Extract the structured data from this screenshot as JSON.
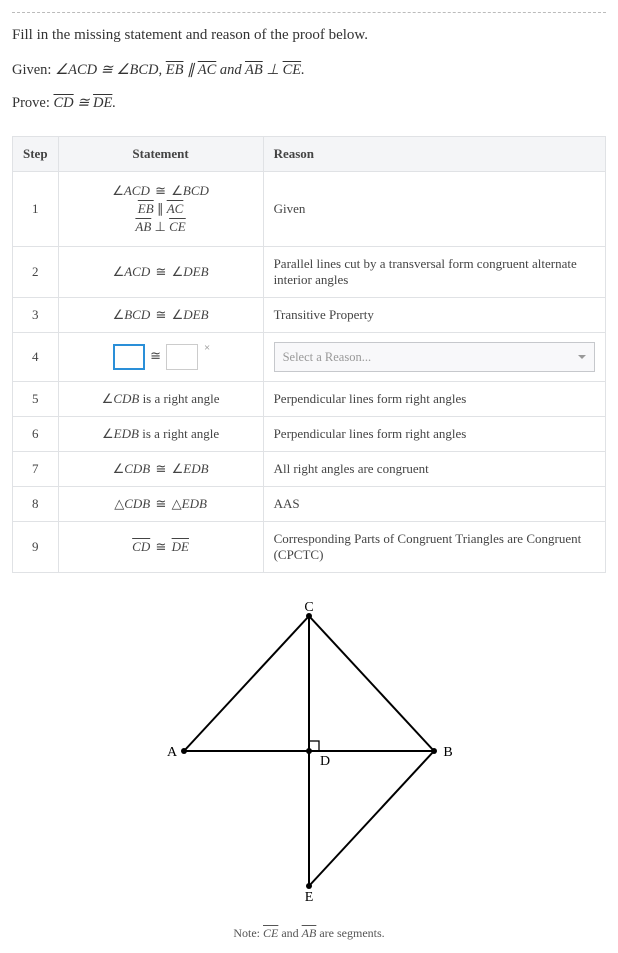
{
  "instruction": "Fill in the missing statement and reason of the proof below.",
  "given_label": "Given: ",
  "given_math": "∠ACD ≅ ∠BCD, EB ∥ AC and AB ⊥ CE.",
  "prove_label": "Prove: ",
  "prove_math": "CD ≅ DE.",
  "headers": {
    "step": "Step",
    "statement": "Statement",
    "reason": "Reason"
  },
  "rows": [
    {
      "step": "1",
      "statements": [
        "∠ACD ≅ ∠BCD",
        "EB ∥ AC",
        "AB ⊥ CE"
      ],
      "reason": "Given"
    },
    {
      "step": "2",
      "statements": [
        "∠ACD ≅ ∠DEB"
      ],
      "reason": "Parallel lines cut by a transversal form congruent alternate interior angles"
    },
    {
      "step": "3",
      "statements": [
        "∠BCD ≅ ∠DEB"
      ],
      "reason": "Transitive Property"
    },
    {
      "step": "4",
      "statements": [
        "__blank__"
      ],
      "reason": "__select__"
    },
    {
      "step": "5",
      "statements": [
        "∠CDB is a right angle"
      ],
      "reason": "Perpendicular lines form right angles"
    },
    {
      "step": "6",
      "statements": [
        "∠EDB is a right angle"
      ],
      "reason": "Perpendicular lines form right angles"
    },
    {
      "step": "7",
      "statements": [
        "∠CDB ≅ ∠EDB"
      ],
      "reason": "All right angles are congruent"
    },
    {
      "step": "8",
      "statements": [
        "△CDB ≅ △EDB"
      ],
      "reason": "AAS"
    },
    {
      "step": "9",
      "statements": [
        "CD ≅ DE"
      ],
      "reason": "Corresponding Parts of Congruent Triangles are Congruent (CPCTC)"
    }
  ],
  "select_placeholder": "Select a Reason...",
  "cong_symbol": "≅",
  "close_symbol": "×",
  "figure": {
    "labels": {
      "A": "A",
      "B": "B",
      "C": "C",
      "D": "D",
      "E": "E"
    }
  },
  "note_prefix": "Note: ",
  "note_mid": " and ",
  "note_suffix": " are segments.",
  "note_seg1": "CE",
  "note_seg2": "AB"
}
